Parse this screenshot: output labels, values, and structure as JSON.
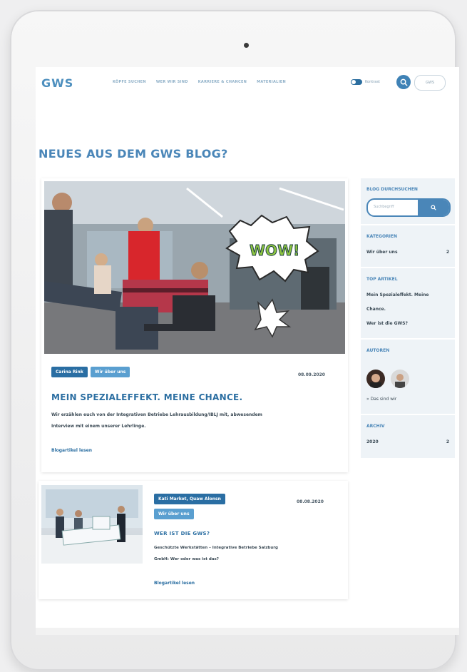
{
  "header": {
    "logo": "GWS",
    "nav": [
      "KÖPFE SUCHEN",
      "WER WIR SIND",
      "KARRIERE & CHANCEN",
      "MATERIALIEN"
    ],
    "toggle_label": "Kontrast",
    "badge_label": "GWS"
  },
  "page_title": "NEUES AUS DEM GWS BLOG?",
  "posts": [
    {
      "tags": [
        "Carina Rink",
        "Wir über uns"
      ],
      "date": "08.09.2020",
      "title": "MEIN SPEZIALEFFEKT. MEINE CHANCE.",
      "excerpt_line1": "Wir erzählen euch von der Integrativen Betriebe Lehrausbildung/IBLJ mit, abwesendem",
      "excerpt_line2": "Interview mit einem unserer Lehrlinge.",
      "more": "Blogartikel lesen",
      "speech_bubble": "WOW!"
    },
    {
      "tags": [
        "Kati Markot, Quaw Alonsn",
        "Wir über uns"
      ],
      "date": "08.08.2020",
      "title": "WER IST DIE GWS?",
      "excerpt_line1": "Geschützte Werkstätten – Integrative Betriebe Salzburg",
      "excerpt_line2": "GmbH: Wer oder was ist das?",
      "more": "Blogartikel lesen"
    }
  ],
  "sidebar": {
    "search_heading": "BLOG DURCHSUCHEN",
    "search_placeholder": "Suchbegriff",
    "categories_heading": "KATEGORIEN",
    "categories": [
      {
        "label": "Wir über uns",
        "count": "2"
      }
    ],
    "top_heading": "TOP ARTIKEL",
    "top": [
      "Mein Spezialeffekt. Meine",
      "Chance.",
      "Wer ist die GWS?"
    ],
    "authors_heading": "AUTOREN",
    "authors_link": "» Das sind wir",
    "archive_heading": "ARCHIV",
    "archive": [
      {
        "label": "2020",
        "count": "2"
      }
    ]
  },
  "colors": {
    "brand": "#2c6fa2",
    "brand_light": "#5a9fd0",
    "sidebar_bg": "#eef3f7"
  }
}
